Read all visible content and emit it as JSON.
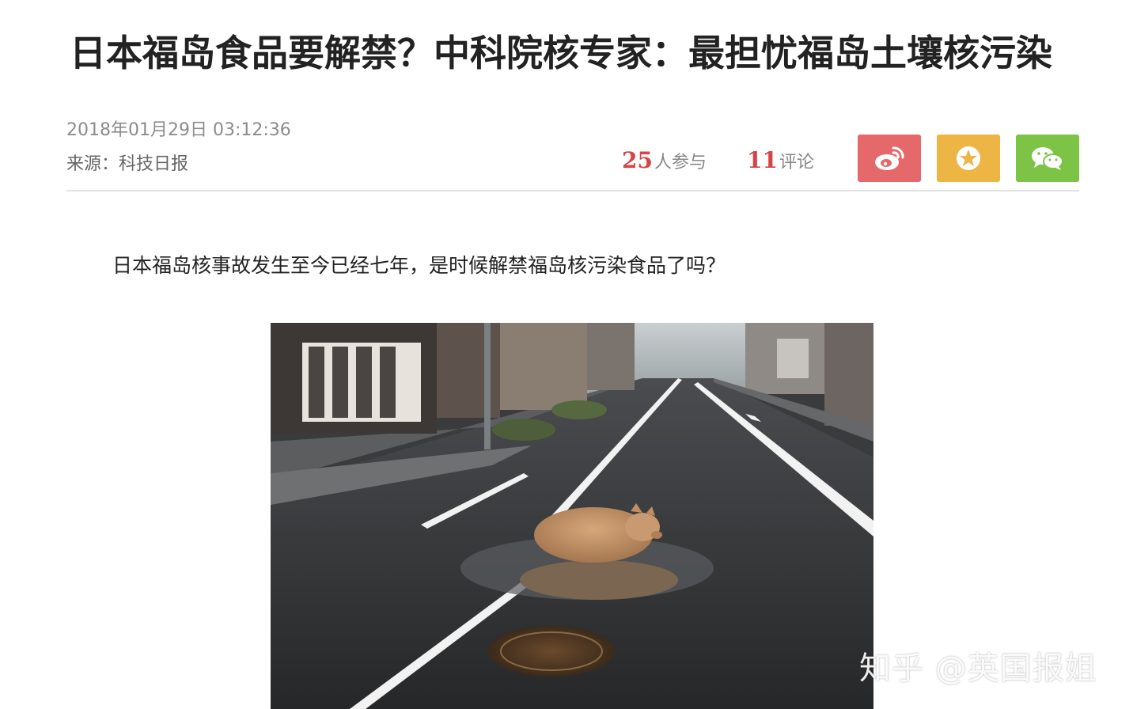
{
  "article": {
    "title": "日本福岛食品要解禁？中科院核专家：最担忧福岛土壤核污染",
    "datetime": "2018年01月29日 03:12:36",
    "source": "来源：科技日报",
    "lead": "日本福岛核事故发生至今已经七年，是时候解禁福岛核污染食品了吗？"
  },
  "stats": {
    "participants_count": "25",
    "participants_label": "人参与",
    "comments_count": "11",
    "comments_label": "评论"
  },
  "share": {
    "weibo": {
      "icon": "weibo-icon",
      "color": "#e5686a"
    },
    "favorite": {
      "icon": "star-icon",
      "color": "#ecb544"
    },
    "wechat": {
      "icon": "wechat-icon",
      "color": "#7cc346"
    }
  },
  "photo": {
    "icon": "news-photo"
  },
  "watermark": {
    "text": "知乎 @英国报姐"
  }
}
